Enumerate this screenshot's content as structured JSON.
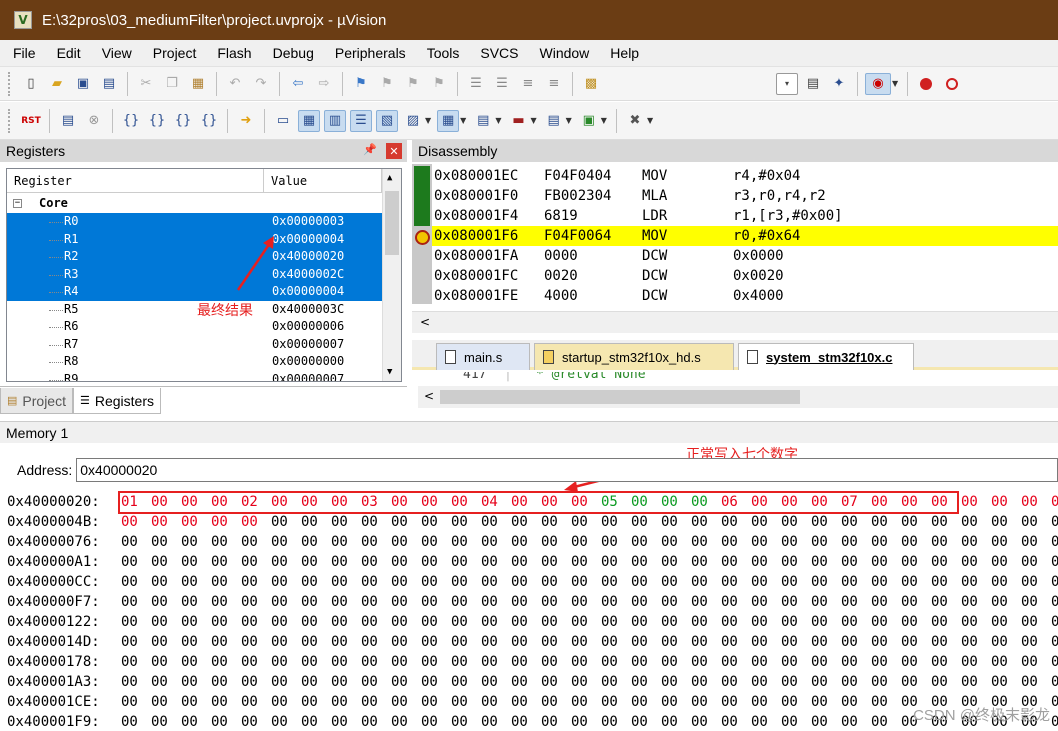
{
  "window": {
    "title": "E:\\32pros\\03_mediumFilter\\project.uvprojx - µVision",
    "app_icon": "µ-icon"
  },
  "menu": [
    "File",
    "Edit",
    "View",
    "Project",
    "Flash",
    "Debug",
    "Peripherals",
    "Tools",
    "SVCS",
    "Window",
    "Help"
  ],
  "registers": {
    "title": "Registers",
    "col_register": "Register",
    "col_value": "Value",
    "group": "Core",
    "rows": [
      {
        "name": "R0",
        "value": "0x00000003",
        "selected": true
      },
      {
        "name": "R1",
        "value": "0x00000004",
        "selected": true
      },
      {
        "name": "R2",
        "value": "0x40000020",
        "selected": true
      },
      {
        "name": "R3",
        "value": "0x4000002C",
        "selected": true
      },
      {
        "name": "R4",
        "value": "0x00000004",
        "selected": true
      },
      {
        "name": "R5",
        "value": "0x4000003C",
        "selected": false
      },
      {
        "name": "R6",
        "value": "0x00000006",
        "selected": false
      },
      {
        "name": "R7",
        "value": "0x00000007",
        "selected": false
      },
      {
        "name": "R8",
        "value": "0x00000000",
        "selected": false
      },
      {
        "name": "R9",
        "value": "0x00000007",
        "selected": false
      }
    ],
    "tabs": [
      "Project",
      "Registers"
    ],
    "annotation": "最终结果"
  },
  "disassembly": {
    "title": "Disassembly",
    "rows": [
      {
        "addr": "0x080001EC",
        "opcode": "F04F0404",
        "mnemonic": "MOV",
        "operands": "r4,#0x04",
        "current": false
      },
      {
        "addr": "0x080001F0",
        "opcode": "FB002304",
        "mnemonic": "MLA",
        "operands": "r3,r0,r4,r2",
        "current": false
      },
      {
        "addr": "0x080001F4",
        "opcode": "6819",
        "mnemonic": "LDR",
        "operands": "r1,[r3,#0x00]",
        "current": false
      },
      {
        "addr": "0x080001F6",
        "opcode": "F04F0064",
        "mnemonic": "MOV",
        "operands": "r0,#0x64",
        "current": true
      },
      {
        "addr": "0x080001FA",
        "opcode": "0000",
        "mnemonic": "DCW",
        "operands": "0x0000",
        "current": false
      },
      {
        "addr": "0x080001FC",
        "opcode": "0020",
        "mnemonic": "DCW",
        "operands": "0x0020",
        "current": false
      },
      {
        "addr": "0x080001FE",
        "opcode": "4000",
        "mnemonic": "DCW",
        "operands": "0x4000",
        "current": false
      }
    ]
  },
  "editor": {
    "tabs": [
      "main.s",
      "startup_stm32f10x_hd.s",
      "system_stm32f10x.c"
    ],
    "active_tab": 2,
    "line_number": "417",
    "line_text": "* @retval None"
  },
  "memory": {
    "title": "Memory 1",
    "address_label": "Address:",
    "address_value": "0x40000020",
    "annotation": "正常写入七个数字",
    "rows": [
      "0x40000020:",
      "0x4000004B:",
      "0x40000076:",
      "0x400000A1:",
      "0x400000CC:",
      "0x400000F7:",
      "0x40000122:",
      "0x4000014D:",
      "0x40000178:",
      "0x400001A3:",
      "0x400001CE:",
      "0x400001F9:"
    ],
    "first_row_bytes": [
      "01",
      "00",
      "00",
      "00",
      "02",
      "00",
      "00",
      "00",
      "03",
      "00",
      "00",
      "00",
      "04",
      "00",
      "00",
      "00",
      "05",
      "00",
      "00",
      "00",
      "06",
      "00",
      "00",
      "00",
      "07",
      "00",
      "00",
      "00",
      "00",
      "00",
      "00",
      "00"
    ],
    "first_row_colors": [
      "red",
      "red",
      "red",
      "red",
      "red",
      "red",
      "red",
      "red",
      "red",
      "red",
      "red",
      "red",
      "red",
      "red",
      "red",
      "red",
      "green",
      "green",
      "green",
      "green",
      "red",
      "red",
      "red",
      "red",
      "red",
      "red",
      "red",
      "red",
      "red",
      "red",
      "red",
      "red"
    ],
    "second_row_red_count": 5,
    "default_byte": "00"
  },
  "watermark": "CSDN @终极末影龙",
  "colors": {
    "title_bar": "#6b3d14",
    "selection": "#0078d7",
    "current_line": "#ffff00",
    "annotation": "#e62020",
    "changed_byte": "#e5001a",
    "green_byte": "#0a9a20"
  }
}
